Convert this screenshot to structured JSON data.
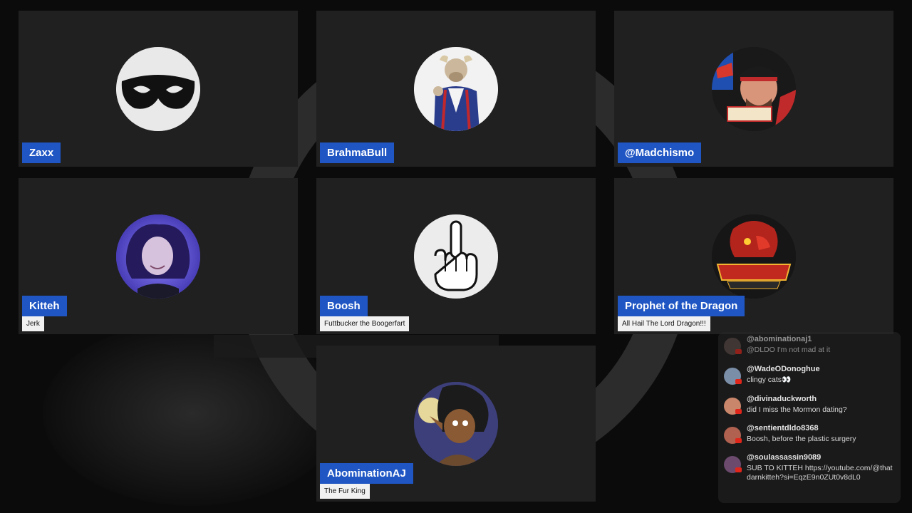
{
  "participants": [
    {
      "name": "Zaxx",
      "caption": "",
      "avatar_icon": "black-domino-mask-icon"
    },
    {
      "name": "BrahmaBull",
      "caption": "",
      "avatar_icon": "bull-in-robe-cartoon-icon"
    },
    {
      "name": "@Madchismo",
      "caption": "",
      "avatar_icon": "man-in-cap-photo-icon"
    },
    {
      "name": "Kitteh",
      "caption": "Jerk",
      "avatar_icon": "woman-purple-light-photo-icon"
    },
    {
      "name": "Boosh",
      "caption": "Futtbucker the Boogerfart",
      "avatar_icon": "middle-finger-icon"
    },
    {
      "name": "Prophet of the Dragon",
      "caption": "All Hail The Lord Dragon!!!",
      "avatar_icon": "red-dragon-logo-icon",
      "logo_text": [
        "PROPHET OF THE DRAGON",
        "ALL HAIL THE LORD DRAGON"
      ]
    },
    {
      "name": "AbominationAJ",
      "caption": "The Fur King",
      "avatar_icon": "horned-creature-cartoon-icon"
    }
  ],
  "chat": {
    "messages": [
      {
        "user": "@abominationaj1",
        "text": "@DLDO I'm not mad at it",
        "avatar_color": "#5a4a46"
      },
      {
        "user": "@WadeODonoghue",
        "text": "clingy cats👀",
        "avatar_color": "#7a8ea8"
      },
      {
        "user": "@divinaduckworth",
        "text": "did I miss the Mormon dating?",
        "avatar_color": "#c9866a"
      },
      {
        "user": "@sentientdldo8368",
        "text": "Boosh, before the plastic surgery",
        "avatar_color": "#b0614f"
      },
      {
        "user": "@soulassassin9089",
        "text": "SUB TO KITTEH https://youtube.com/@thatdarnkitteh?si=EqzE9n0ZUt0v8dL0",
        "avatar_color": "#6b4a6e"
      }
    ]
  },
  "colors": {
    "nameplate": "#1f56c4",
    "tile": "#202020",
    "background": "#0b0b0b"
  }
}
